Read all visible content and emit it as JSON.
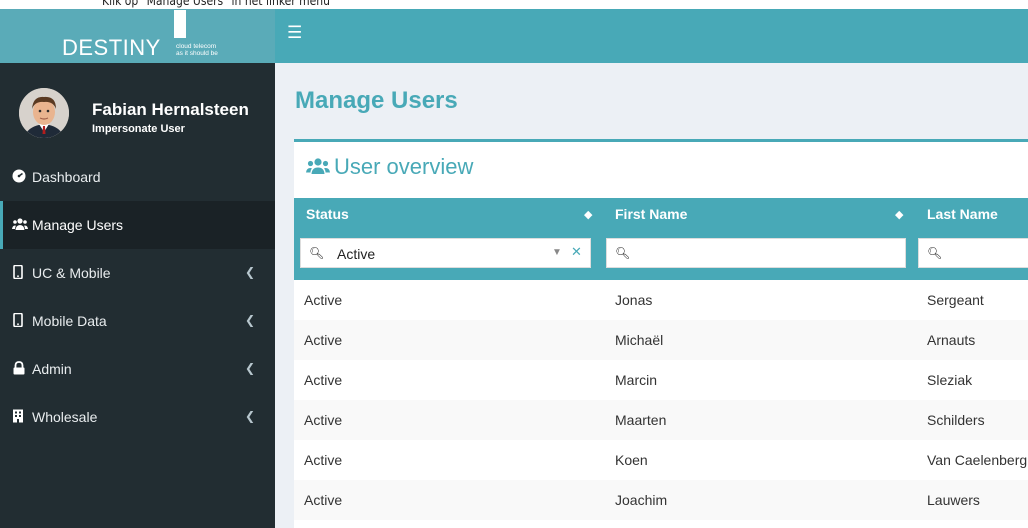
{
  "caption": "Klik op \"Manage Users\" in het linker menu",
  "brand": {
    "name": "DESTINY",
    "tagline_line1": "cloud telecom",
    "tagline_line2": "as it should be",
    "accent": "#48a9b7"
  },
  "topbar": {
    "menu_icon": "hamburger-icon"
  },
  "user": {
    "name": "Fabian Hernalsteen",
    "subtitle": "Impersonate User"
  },
  "sidebar": {
    "items": [
      {
        "label": "Dashboard",
        "icon": "dashboard-icon",
        "active": false,
        "has_children": false
      },
      {
        "label": "Manage Users",
        "icon": "users-icon",
        "active": true,
        "has_children": false
      },
      {
        "label": "UC & Mobile",
        "icon": "mobile-icon",
        "active": false,
        "has_children": true
      },
      {
        "label": "Mobile Data",
        "icon": "mobile-icon",
        "active": false,
        "has_children": true
      },
      {
        "label": "Admin",
        "icon": "lock-icon",
        "active": false,
        "has_children": true
      },
      {
        "label": "Wholesale",
        "icon": "building-icon",
        "active": false,
        "has_children": true
      }
    ]
  },
  "main": {
    "page_title": "Manage Users",
    "box_title": "User overview"
  },
  "table": {
    "columns": [
      "Status",
      "First Name",
      "Last Name"
    ],
    "filters": {
      "status": "Active",
      "first_name": "",
      "last_name": ""
    },
    "rows": [
      [
        "Active",
        "Jonas",
        "Sergeant"
      ],
      [
        "Active",
        "Michaël",
        "Arnauts"
      ],
      [
        "Active",
        "Marcin",
        "Sleziak"
      ],
      [
        "Active",
        "Maarten",
        "Schilders"
      ],
      [
        "Active",
        "Koen",
        "Van Caelenberg"
      ],
      [
        "Active",
        "Joachim",
        "Lauwers"
      ]
    ]
  }
}
